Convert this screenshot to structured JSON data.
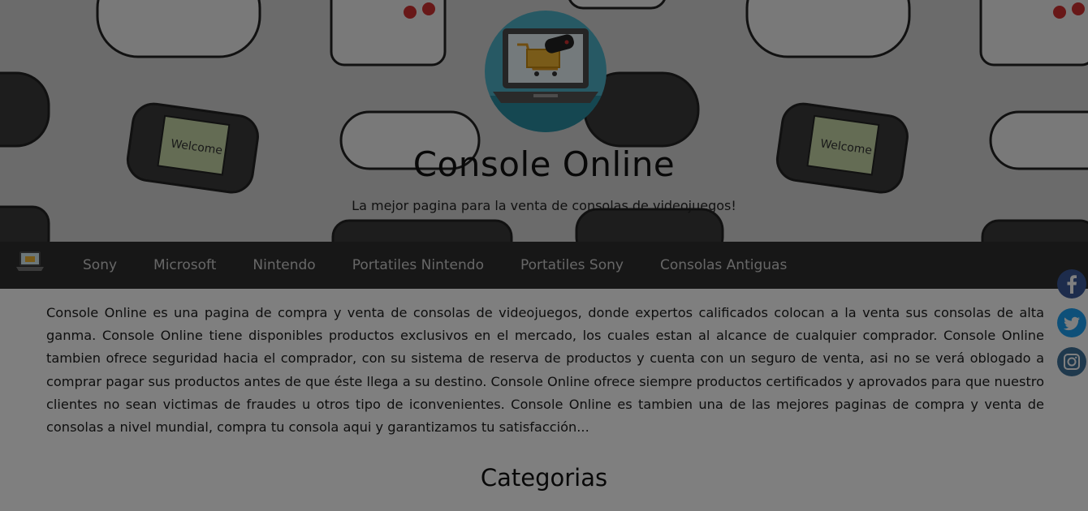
{
  "header": {
    "title": "Console Online",
    "subtitle": "La mejor pagina para la venta de consolas de videojuegos!",
    "pattern_text": "Welcome"
  },
  "nav": {
    "items": [
      {
        "label": "Sony"
      },
      {
        "label": "Microsoft"
      },
      {
        "label": "Nintendo"
      },
      {
        "label": "Portatiles Nintendo"
      },
      {
        "label": "Portatiles Sony"
      },
      {
        "label": "Consolas Antiguas"
      }
    ]
  },
  "main": {
    "intro": "Console Online es una pagina de compra y venta de consolas de videojuegos, donde expertos calificados colocan a la venta sus consolas de alta ganma. Console Online tiene disponibles productos exclusivos en el mercado, los cuales estan al alcance de cualquier comprador. Console Online tambien ofrece seguridad hacia el comprador, con su sistema de reserva de productos y cuenta con un seguro de venta, asi no se verá oblogado a comprar pagar sus productos antes de que éste llega a su destino. Console Online ofrece siempre productos certificados y aprovados para que nuestro clientes no sean victimas de fraudes u otros tipo de iconvenientes. Console Online es tambien una de las mejores paginas de compra y venta de consolas a nivel mundial, compra tu consola aqui y garantizamos tu satisfacción...",
    "section_title": "Categorias"
  },
  "social": {
    "icons": [
      "facebook-icon",
      "twitter-icon",
      "instagram-icon"
    ],
    "colors": {
      "facebook": "#3b5998",
      "twitter": "#1da1f2",
      "instagram": "#3f729b"
    }
  },
  "colors": {
    "nav_bg": "#2e2e2e",
    "overlay": "rgba(0,0,0,0.5)",
    "logo_circle": "#4fb3c9"
  }
}
